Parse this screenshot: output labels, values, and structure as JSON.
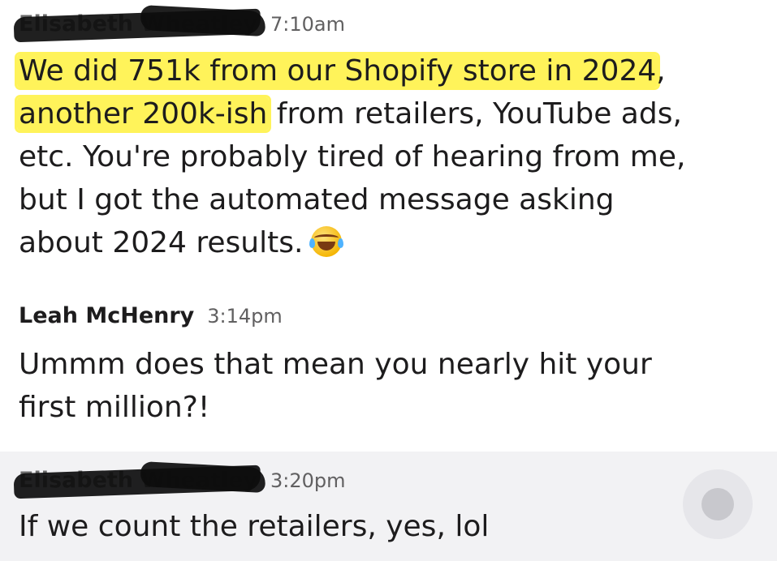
{
  "messages": [
    {
      "sender": "Elisabeth Wheatley",
      "sender_redacted": true,
      "time": "7:10am",
      "lines": [
        [
          {
            "text": "We did 751k from our Shopify store in 2024",
            "highlight": true
          },
          {
            "text": ",",
            "highlight": false
          }
        ],
        [
          {
            "text": "another 200k-ish",
            "highlight": true
          },
          {
            "text": " from retailers, YouTube ads,",
            "highlight": false
          }
        ],
        [
          {
            "text": "etc. You're probably tired of hearing from me,",
            "highlight": false
          }
        ],
        [
          {
            "text": "but I got the automated message asking",
            "highlight": false
          }
        ],
        [
          {
            "text": "about 2024 results.",
            "highlight": false
          }
        ]
      ],
      "emoji": "face-with-tears-of-joy"
    },
    {
      "sender": "Leah McHenry",
      "sender_redacted": false,
      "time": "3:14pm",
      "lines": [
        [
          {
            "text": "Ummm does that mean you nearly hit your",
            "highlight": false
          }
        ],
        [
          {
            "text": "first million?!",
            "highlight": false
          }
        ]
      ]
    },
    {
      "sender": "Elisabeth Wheatley",
      "sender_redacted": true,
      "time": "3:20pm",
      "lines": [
        [
          {
            "text": "If we count the retailers, yes, lol",
            "highlight": false
          }
        ]
      ]
    }
  ],
  "colors": {
    "highlight": "#fff35a",
    "hover_background": "#f2f2f4",
    "text": "#1d1c1d",
    "timestamp": "#616061"
  },
  "icons": {
    "message_action": "circle-action-icon"
  }
}
